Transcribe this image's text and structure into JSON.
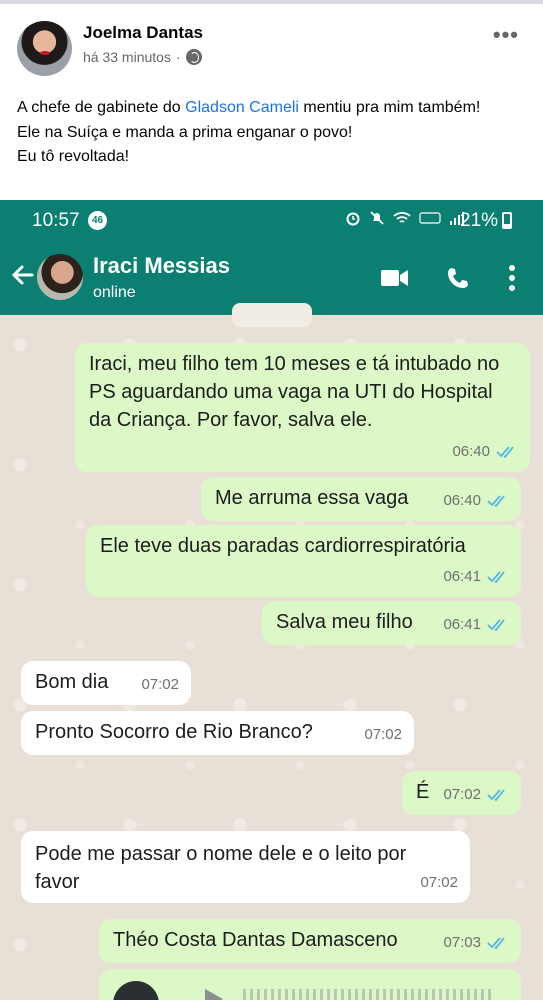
{
  "post": {
    "author": "Joelma Dantas",
    "time": "há 33 minutos",
    "text_before_link": "A chefe de gabinete do ",
    "link_text": "Gladson Cameli",
    "text_after_link": " mentiu pra mim também!",
    "line2": "Ele na Suíça e manda a prima enganar o povo!",
    "line3": "Eu tô revoltada!",
    "more_icon": "more-horizontal-icon",
    "privacy_icon": "globe-icon"
  },
  "status_bar": {
    "time": "10:57",
    "badge": "46",
    "battery_pct": "21%",
    "battery_level": 0.21
  },
  "chat_header": {
    "contact_name": "Iraci Messias",
    "status": "online"
  },
  "messages": [
    {
      "dir": "out",
      "text": "Iraci, meu filho tem 10 meses e tá intubado no PS aguardando uma vaga na UTI do Hospital da Criança. Por favor, salva ele.",
      "time": "06:40",
      "read": true
    },
    {
      "dir": "out",
      "text": "Me arruma essa vaga",
      "time": "06:40",
      "read": true
    },
    {
      "dir": "out",
      "text": "Ele teve duas paradas cardiorrespiratória",
      "time": "06:41",
      "read": true
    },
    {
      "dir": "out",
      "text": "Salva meu filho",
      "time": "06:41",
      "read": true
    },
    {
      "dir": "in",
      "text": "Bom dia",
      "time": "07:02"
    },
    {
      "dir": "in",
      "text": "Pronto Socorro de Rio Branco?",
      "time": "07:02"
    },
    {
      "dir": "out",
      "text": "É",
      "time": "07:02",
      "read": true
    },
    {
      "dir": "in",
      "text": "Pode me passar o nome dele e o leito por favor",
      "time": "07:02"
    },
    {
      "dir": "out",
      "text": "Théo Costa Dantas Damasceno",
      "time": "07:03",
      "read": true
    }
  ],
  "colors": {
    "whatsapp_teal": "#0b7f72",
    "outgoing_bubble": "#dcf8c6",
    "incoming_bubble": "#ffffff",
    "read_ticks": "#4fb6ec",
    "facebook_link": "#1b74e4"
  }
}
